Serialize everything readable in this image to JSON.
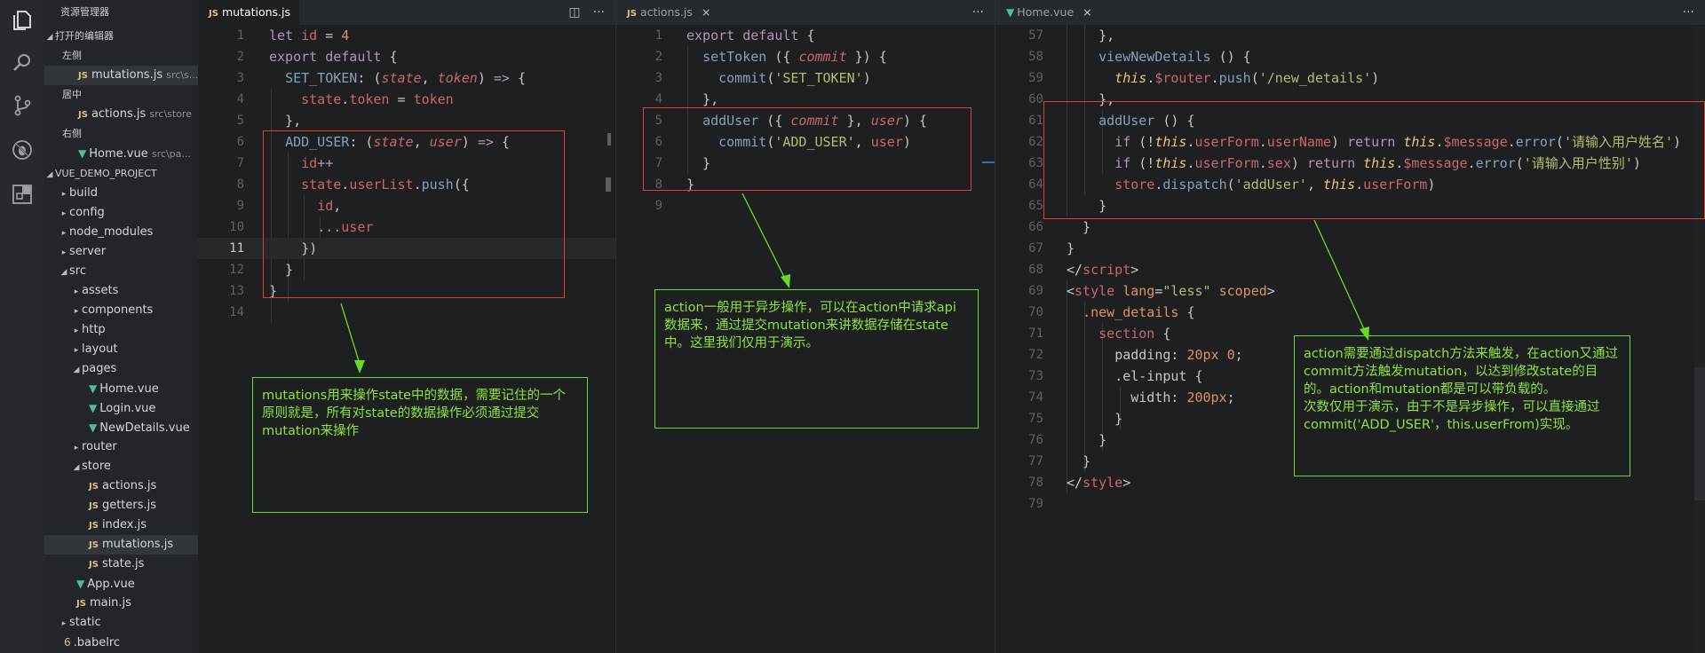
{
  "sidebar": {
    "title": "资源管理器",
    "open_editors_label": "打开的编辑器",
    "open_editors": [
      {
        "group": "左侧",
        "name": "mutations.js",
        "path": "src\\s..."
      },
      {
        "group": "居中",
        "name": "actions.js",
        "path": "src\\store"
      },
      {
        "group": "右侧",
        "name": "Home.vue",
        "path": "src\\pa..."
      }
    ],
    "project_label": "VUE_DEMO_PROJECT",
    "tree": [
      {
        "label": "build",
        "kind": "folder"
      },
      {
        "label": "config",
        "kind": "folder"
      },
      {
        "label": "node_modules",
        "kind": "folder"
      },
      {
        "label": "server",
        "kind": "folder"
      },
      {
        "label": "src",
        "kind": "folder-open"
      },
      {
        "label": "assets",
        "kind": "folder"
      },
      {
        "label": "components",
        "kind": "folder"
      },
      {
        "label": "http",
        "kind": "folder"
      },
      {
        "label": "layout",
        "kind": "folder"
      },
      {
        "label": "pages",
        "kind": "folder-open"
      },
      {
        "label": "Home.vue",
        "kind": "vue"
      },
      {
        "label": "Login.vue",
        "kind": "vue"
      },
      {
        "label": "NewDetails.vue",
        "kind": "vue"
      },
      {
        "label": "router",
        "kind": "folder"
      },
      {
        "label": "store",
        "kind": "folder-open"
      },
      {
        "label": "actions.js",
        "kind": "js"
      },
      {
        "label": "getters.js",
        "kind": "js"
      },
      {
        "label": "index.js",
        "kind": "js"
      },
      {
        "label": "mutations.js",
        "kind": "js"
      },
      {
        "label": "state.js",
        "kind": "js"
      },
      {
        "label": "App.vue",
        "kind": "vue"
      },
      {
        "label": "main.js",
        "kind": "js"
      },
      {
        "label": "static",
        "kind": "folder"
      },
      {
        "label": ".babelrc",
        "kind": "file"
      }
    ]
  },
  "tabs": {
    "left": {
      "badge": "JS",
      "name": "mutations.js"
    },
    "center": {
      "badge": "JS",
      "name": "actions.js",
      "close": "×"
    },
    "right": {
      "badge": "▼",
      "name": "Home.vue",
      "close": "×"
    },
    "more": "···",
    "split": "◫"
  },
  "editor_left": {
    "line_numbers": [
      "1",
      "2",
      "3",
      "4",
      "5",
      "6",
      "7",
      "8",
      "9",
      "10",
      "11",
      "12",
      "13",
      "14"
    ]
  },
  "editor_center": {
    "line_numbers": [
      "1",
      "2",
      "3",
      "4",
      "5",
      "6",
      "7",
      "8",
      "9"
    ]
  },
  "editor_right": {
    "line_numbers": [
      "57",
      "58",
      "59",
      "60",
      "61",
      "62",
      "63",
      "64",
      "65",
      "66",
      "67",
      "68",
      "69",
      "70",
      "71",
      "72",
      "73",
      "74",
      "75",
      "76",
      "77",
      "78",
      "79"
    ]
  },
  "notes": {
    "mutations": "mutations用来操作state中的数据，需要记住的一个原则就是，所有对state的数据操作必须通过提交mutation来操作",
    "actions": "action一般用于异步操作，可以在action中请求api数据来，通过提交mutation来讲数据存储在state中。这里我们仅用于演示。",
    "home_1": "action需要通过dispatch方法来触发，在action又通过commit方法触发mutation，以达到修改state的目的。action和mutation都是可以带负载的。",
    "home_2": "次数仅用于演示，由于不是异步操作，可以直接通过commit('ADD_USER'，this.userFrom)实现。"
  }
}
